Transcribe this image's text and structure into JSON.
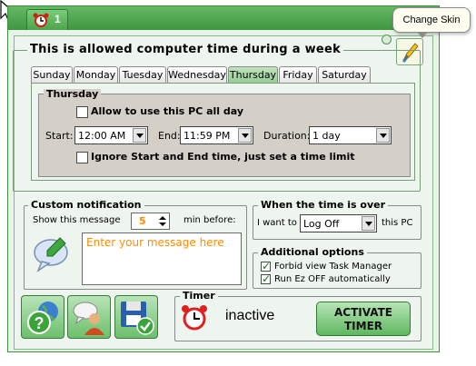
{
  "titlebar": {
    "tab_number": "1"
  },
  "tooltip": {
    "text": "Change Skin"
  },
  "main": {
    "title": "This is allowed computer time during a week"
  },
  "days": [
    {
      "label": "Sunday",
      "active": false
    },
    {
      "label": "Monday",
      "active": false
    },
    {
      "label": "Tuesday",
      "active": false
    },
    {
      "label": "Wednesday",
      "active": false
    },
    {
      "label": "Thursday",
      "active": true
    },
    {
      "label": "Friday",
      "active": false
    },
    {
      "label": "Saturday",
      "active": false
    }
  ],
  "day_panel": {
    "title": "Thursday",
    "allow_all_day_label": "Allow to use this PC all day",
    "allow_all_day_checked": false,
    "start_label": "Start:",
    "start_value": "12:00 AM",
    "end_label": "End:",
    "end_value": "11:59 PM",
    "duration_label": "Duration:",
    "duration_value": "1 day",
    "ignore_label": "Ignore Start and End time, just set a time limit",
    "ignore_checked": false
  },
  "notification": {
    "title": "Custom notification",
    "show_label": "Show this message",
    "minutes_value": "5",
    "minutes_label": "min before:",
    "message_placeholder": "Enter your message here"
  },
  "time_over": {
    "title": "When the time is over",
    "prefix": "I want to",
    "action_value": "Log Off",
    "suffix": "this PC"
  },
  "additional": {
    "title": "Additional options",
    "options": [
      {
        "label": "Forbid view Task Manager",
        "checked": true
      },
      {
        "label": "Run Ez OFF automatically",
        "checked": true
      }
    ]
  },
  "timer": {
    "title": "Timer",
    "status": "inactive",
    "activate_line1": "ACTIVATE",
    "activate_line2": "TIMER"
  },
  "colors": {
    "accent_green": "#4aa44a",
    "placeholder_orange": "#ff8c00",
    "panel_gray": "#d4d0c8"
  },
  "icons": {
    "titlebar": "alarm-clock-icon",
    "skin": "brush-icon",
    "notification": "speech-bubble-edit-icon",
    "help": "help-globe-icon",
    "support": "chat-person-icon",
    "save": "save-check-icon",
    "timer": "alarm-clock-icon"
  }
}
